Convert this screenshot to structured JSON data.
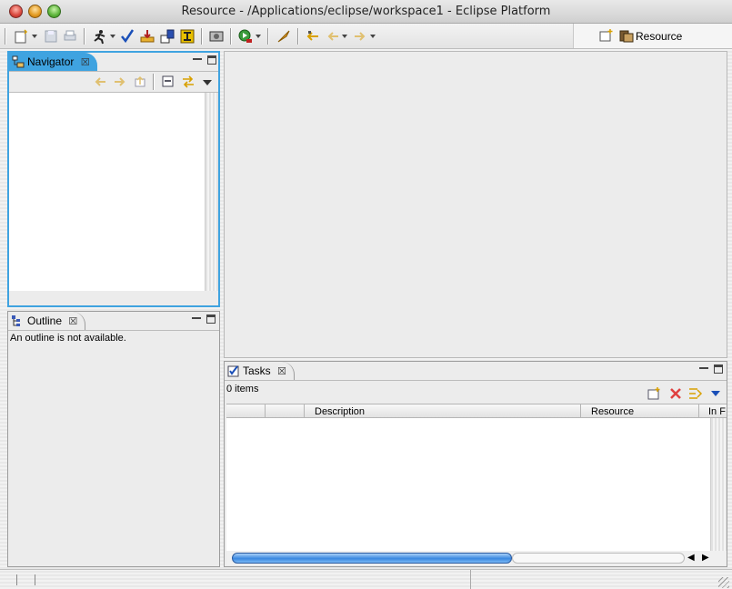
{
  "window": {
    "title": "Resource - /Applications/eclipse/workspace1 - Eclipse Platform"
  },
  "toolbar": {
    "icons": [
      "new-wizard-icon",
      "save-icon",
      "print-icon",
      "run-last-tool-icon",
      "check-icon",
      "export-icon",
      "import-icon",
      "open-type-icon",
      "build-icon",
      "run-icon",
      "external-tools-icon",
      "last-edit-location-icon",
      "back-icon",
      "forward-icon"
    ]
  },
  "perspective": {
    "label": "Resource",
    "icons": [
      "open-perspective-icon",
      "resource-perspective-icon"
    ]
  },
  "navigator": {
    "tab_label": "Navigator",
    "toolbar_icons": [
      "back-icon",
      "forward-icon",
      "up-icon",
      "collapse-all-icon",
      "link-editor-icon",
      "view-menu-icon"
    ]
  },
  "outline": {
    "tab_label": "Outline",
    "message": "An outline is not available."
  },
  "tasks": {
    "tab_label": "Tasks",
    "count_text": "0 items",
    "columns": [
      "",
      "",
      "Description",
      "Resource",
      "In F"
    ],
    "toolbar_icons": [
      "new-task-icon",
      "delete-icon",
      "filter-icon",
      "view-menu-icon"
    ]
  },
  "colors": {
    "active_tab": "#3fa3e0",
    "panel_border": "#9c9c9c"
  }
}
